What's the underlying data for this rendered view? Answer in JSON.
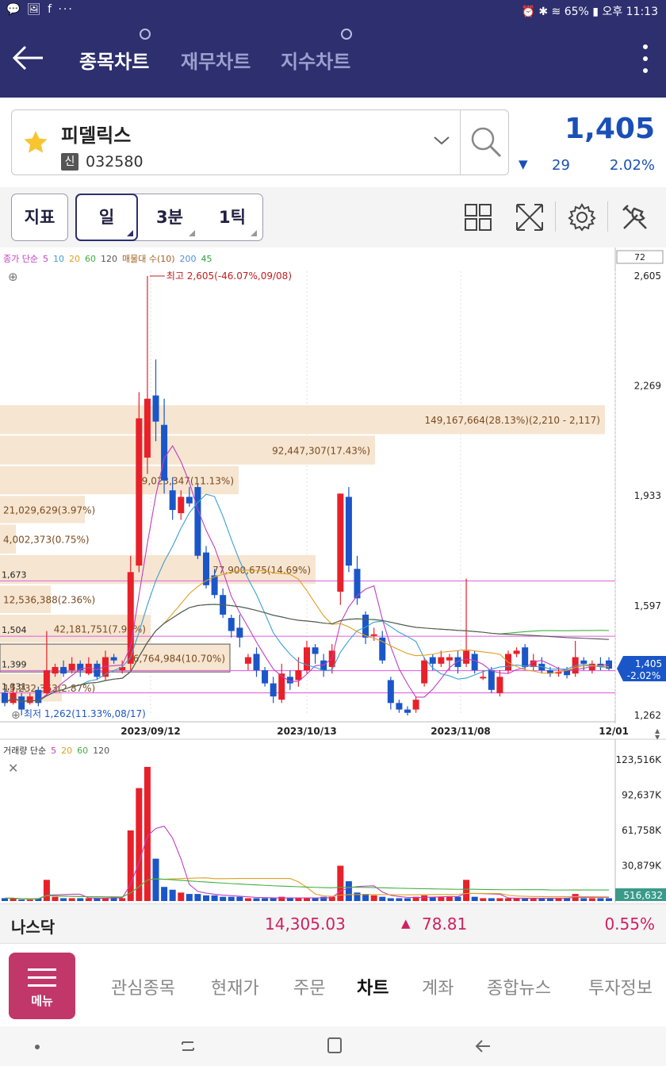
{
  "status_bar": {
    "left_icons": "💬 🖼 f ···",
    "battery": "65%",
    "time": "오후 11:13",
    "right_icons": "⏰ ✱ ≋"
  },
  "app_bar": {
    "tabs": [
      {
        "label": "종목차트",
        "active": true
      },
      {
        "label": "재무차트",
        "active": false
      },
      {
        "label": "지수차트",
        "active": false
      }
    ]
  },
  "stock": {
    "name": "피델릭스",
    "badge": "신",
    "code": "032580",
    "price": "1,405",
    "change_arrow": "▼",
    "change": "29",
    "change_pct": "2.02%"
  },
  "toolbar": {
    "indicator_label": "지표",
    "periods": [
      "일",
      "3분",
      "1틱"
    ]
  },
  "chart": {
    "legend": [
      {
        "text": "종가 단순",
        "color": "#c040c0"
      },
      {
        "text": "5",
        "color": "#c040c0"
      },
      {
        "text": "10",
        "color": "#3aa0d0"
      },
      {
        "text": "20",
        "color": "#e0a020"
      },
      {
        "text": "60",
        "color": "#40b040"
      },
      {
        "text": "120",
        "color": "#555555"
      },
      {
        "text": "매물대 수(10)",
        "color": "#a06020"
      },
      {
        "text": "200",
        "color": "#5090e0"
      },
      {
        "text": "45",
        "color": "#30a040"
      }
    ],
    "count_box": "72",
    "y_labels": [
      "2,605",
      "2,269",
      "1,933",
      "1,597",
      "1,262"
    ],
    "x_labels": [
      "2023/09/12",
      "2023/10/13",
      "2023/11/08",
      "12/01"
    ],
    "high_label": "최고 2,605(-46.07%,09/08)",
    "low_label": "최저 1,262(11.33%,08/17)",
    "current_price_tag": "1,405",
    "current_pct_tag": "-2.02%",
    "h_lines": [
      "1,673",
      "1,504",
      "1,399",
      "1,331"
    ],
    "volume_profile": [
      {
        "label": "149,167,664(28.13%)(2,210 - 2,117)"
      },
      {
        "label": "92,447,307(17.43%)"
      },
      {
        "label": "59,023,347(11.13%)"
      },
      {
        "label": "21,029,629(3.97%)"
      },
      {
        "label": "4,002,373(0.75%)"
      },
      {
        "label": "77,900,675(14.69%)"
      },
      {
        "label": "12,536,388(2.36%)"
      },
      {
        "label": "42,181,751(7.95%)"
      },
      {
        "label": "56,764,984(10.70%)"
      },
      {
        "label": "15,232,363(2.87%)"
      }
    ],
    "volume_legend": [
      {
        "text": "거래량 단순",
        "color": "#333333"
      },
      {
        "text": "5",
        "color": "#c040c0"
      },
      {
        "text": "20",
        "color": "#e0a020"
      },
      {
        "text": "60",
        "color": "#40b040"
      },
      {
        "text": "120",
        "color": "#555555"
      }
    ],
    "volume_y_labels": [
      "123,516K",
      "92,637K",
      "61,758K",
      "30,879K"
    ],
    "volume_current": "516,632",
    "candles": [
      [
        1331,
        1300,
        1340,
        1290
      ],
      [
        1300,
        1331,
        1345,
        1295
      ],
      [
        1320,
        1280,
        1330,
        1262
      ],
      [
        1300,
        1320,
        1330,
        1295
      ],
      [
        1340,
        1300,
        1350,
        1290
      ],
      [
        1330,
        1400,
        1520,
        1320
      ],
      [
        1390,
        1410,
        1420,
        1380
      ],
      [
        1410,
        1390,
        1430,
        1380
      ],
      [
        1400,
        1420,
        1440,
        1390
      ],
      [
        1420,
        1400,
        1430,
        1380
      ],
      [
        1390,
        1420,
        1440,
        1385
      ],
      [
        1420,
        1380,
        1430,
        1370
      ],
      [
        1380,
        1440,
        1460,
        1370
      ],
      [
        1440,
        1430,
        1450,
        1420
      ],
      [
        1400,
        1410,
        1430,
        1390
      ],
      [
        1420,
        1700,
        1750,
        1400
      ],
      [
        1720,
        2170,
        2250,
        1700
      ],
      [
        2050,
        2230,
        2605,
        2000
      ],
      [
        2240,
        2160,
        2350,
        2100
      ],
      [
        2150,
        1980,
        2230,
        1940
      ],
      [
        1950,
        1890,
        1990,
        1860
      ],
      [
        1880,
        1930,
        1950,
        1860
      ],
      [
        1930,
        1910,
        1960,
        1900
      ],
      [
        1960,
        1750,
        1970,
        1740
      ],
      [
        1760,
        1660,
        1780,
        1650
      ],
      [
        1690,
        1630,
        1710,
        1620
      ],
      [
        1630,
        1570,
        1650,
        1560
      ],
      [
        1560,
        1520,
        1570,
        1500
      ],
      [
        1530,
        1500,
        1570,
        1470
      ],
      [
        1420,
        1440,
        1450,
        1400
      ],
      [
        1450,
        1400,
        1470,
        1380
      ],
      [
        1400,
        1360,
        1410,
        1350
      ],
      [
        1360,
        1320,
        1380,
        1300
      ],
      [
        1310,
        1390,
        1420,
        1300
      ],
      [
        1380,
        1360,
        1400,
        1340
      ],
      [
        1370,
        1400,
        1440,
        1350
      ],
      [
        1400,
        1470,
        1490,
        1390
      ],
      [
        1470,
        1450,
        1480,
        1420
      ],
      [
        1430,
        1400,
        1450,
        1380
      ],
      [
        1410,
        1460,
        1480,
        1390
      ],
      [
        1640,
        1940,
        1940,
        1600
      ],
      [
        1930,
        1720,
        1960,
        1700
      ],
      [
        1710,
        1620,
        1750,
        1600
      ],
      [
        1570,
        1500,
        1580,
        1480
      ],
      [
        1510,
        1510,
        1530,
        1490
      ],
      [
        1500,
        1430,
        1520,
        1420
      ],
      [
        1370,
        1300,
        1380,
        1280
      ],
      [
        1300,
        1280,
        1310,
        1270
      ],
      [
        1280,
        1270,
        1290,
        1262
      ],
      [
        1280,
        1310,
        1320,
        1270
      ],
      [
        1360,
        1430,
        1440,
        1350
      ],
      [
        1440,
        1420,
        1450,
        1400
      ],
      [
        1420,
        1440,
        1460,
        1410
      ],
      [
        1430,
        1440,
        1450,
        1400
      ],
      [
        1440,
        1410,
        1460,
        1390
      ],
      [
        1420,
        1460,
        1680,
        1410
      ],
      [
        1450,
        1400,
        1460,
        1390
      ],
      [
        1380,
        1380,
        1400,
        1370
      ],
      [
        1400,
        1340,
        1410,
        1330
      ],
      [
        1330,
        1380,
        1400,
        1320
      ],
      [
        1400,
        1450,
        1460,
        1390
      ],
      [
        1450,
        1460,
        1470,
        1440
      ],
      [
        1470,
        1410,
        1480,
        1400
      ],
      [
        1410,
        1430,
        1450,
        1400
      ],
      [
        1420,
        1400,
        1440,
        1390
      ],
      [
        1400,
        1390,
        1410,
        1380
      ],
      [
        1390,
        1395,
        1410,
        1380
      ],
      [
        1400,
        1385,
        1410,
        1375
      ],
      [
        1390,
        1440,
        1490,
        1380
      ],
      [
        1430,
        1420,
        1440,
        1400
      ],
      [
        1400,
        1420,
        1430,
        1390
      ],
      [
        1420,
        1410,
        1440,
        1400
      ],
      [
        1430,
        1405,
        1440,
        1400
      ]
    ],
    "volumes": [
      2,
      2,
      1,
      1,
      2,
      15,
      3,
      2,
      2,
      2,
      2,
      2,
      2,
      3,
      2,
      50,
      80,
      95,
      30,
      10,
      8,
      6,
      5,
      5,
      4,
      4,
      3,
      3,
      3,
      2,
      2,
      2,
      2,
      3,
      2,
      2,
      2,
      2,
      3,
      3,
      25,
      14,
      6,
      5,
      4,
      3,
      2,
      2,
      2,
      3,
      4,
      3,
      3,
      3,
      3,
      15,
      3,
      2,
      2,
      2,
      2,
      2,
      2,
      2,
      2,
      2,
      2,
      2,
      5,
      2,
      2,
      2,
      2
    ]
  },
  "index_bar": {
    "name": "나스닥",
    "value": "14,305.03",
    "arrow": "▲",
    "change": "78.81",
    "pct": "0.55%"
  },
  "nav": {
    "menu_label": "메뉴",
    "items": [
      {
        "label": "관심종목",
        "active": false
      },
      {
        "label": "현재가",
        "active": false
      },
      {
        "label": "주문",
        "active": false
      },
      {
        "label": "차트",
        "active": true
      },
      {
        "label": "계좌",
        "active": false
      },
      {
        "label": "종합뉴스",
        "active": false
      },
      {
        "label": "투자정보",
        "active": false
      }
    ]
  }
}
